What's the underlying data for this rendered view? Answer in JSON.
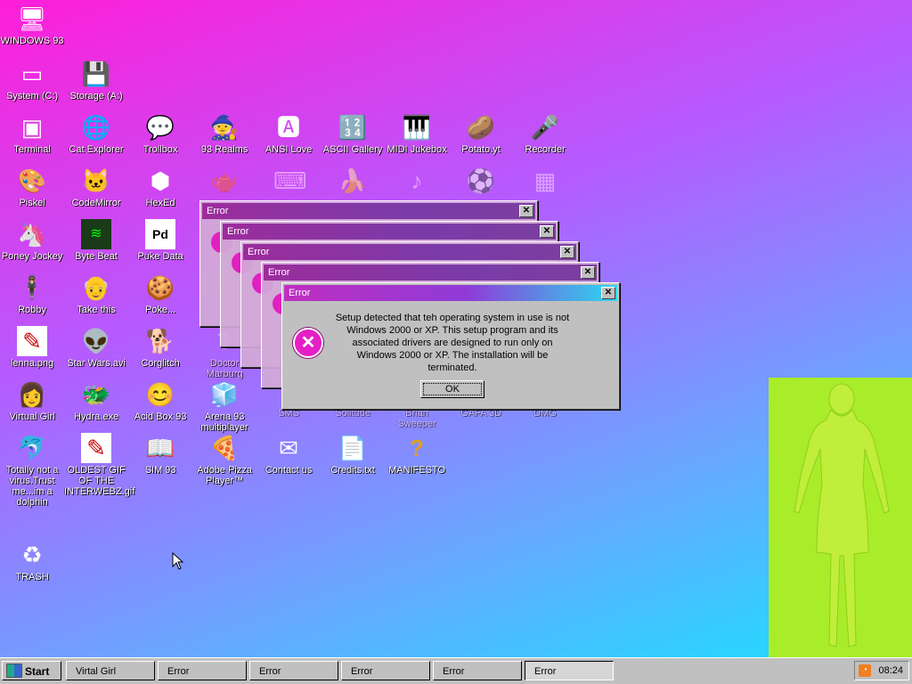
{
  "colors": {
    "error_icon": "#e61ec6",
    "title_gradient_start": "#c02ec0",
    "title_gradient_end": "#2bd8ef",
    "virtual_girl_bg": "#a8ec2a"
  },
  "desktop_icons": [
    {
      "label": "WINDOWS 93",
      "icon": "computer-icon"
    },
    {
      "label": "System (C:)",
      "icon": "drive-icon"
    },
    {
      "label": "Storage (A:)",
      "icon": "floppy-icon"
    },
    {
      "label": "Terminal",
      "icon": "terminal-icon"
    },
    {
      "label": "Cat Explorer",
      "icon": "cat-explorer-icon"
    },
    {
      "label": "Trollbox",
      "icon": "chat-bubble-icon"
    },
    {
      "label": "93 Realms",
      "icon": "realms-icon"
    },
    {
      "label": "ANSI Love",
      "icon": "ansi-icon"
    },
    {
      "label": "ASCII Gallery",
      "icon": "ascii-icon"
    },
    {
      "label": "MIDI Jukebox",
      "icon": "piano-icon"
    },
    {
      "label": "Potato.yt",
      "icon": "potato-icon"
    },
    {
      "label": "Recorder",
      "icon": "microphone-icon"
    },
    {
      "label": "Piskel",
      "icon": "palette-icon"
    },
    {
      "label": "CodeMirror",
      "icon": "codemirror-icon"
    },
    {
      "label": "HexEd",
      "icon": "hexed-icon"
    },
    {
      "label": "Poney Jockey",
      "icon": "pony-icon"
    },
    {
      "label": "Byte Beat",
      "icon": "bytebeat-icon"
    },
    {
      "label": "Puke Data",
      "icon": "pd-icon"
    },
    {
      "label": "Robby",
      "icon": "robby-icon"
    },
    {
      "label": "Take this",
      "icon": "take-this-icon"
    },
    {
      "label": "Poke...",
      "icon": "cookie-icon"
    },
    {
      "label": "lenna.png",
      "icon": "image-file-icon"
    },
    {
      "label": "Star Wars.avi",
      "icon": "yoda-icon"
    },
    {
      "label": "Corglitch",
      "icon": "corgi-icon"
    },
    {
      "label": "Doctor Marburg",
      "icon": "doctor-icon"
    },
    {
      "label": "Virtual Girl",
      "icon": "virtual-girl-icon"
    },
    {
      "label": "Hydra.exe",
      "icon": "hydra-icon"
    },
    {
      "label": "Acid Box 93",
      "icon": "smiley-icon"
    },
    {
      "label": "Arena 93 multiplayer",
      "icon": "cube-icon"
    },
    {
      "label": "SMS",
      "icon": "sms-icon"
    },
    {
      "label": "Solitude",
      "icon": "solitude-icon"
    },
    {
      "label": "Brian Sweeper",
      "icon": "sweeper-icon"
    },
    {
      "label": "GAFA 3D",
      "icon": "gafa-icon"
    },
    {
      "label": "DMG",
      "icon": "dmg-icon"
    },
    {
      "label": "Totally not a virus.Trust me...im a dolphin",
      "icon": "dolphin-icon"
    },
    {
      "label": "OLDEST GIF OF THE INTERWEBZ.gif",
      "icon": "gif-file-icon"
    },
    {
      "label": "SIM 93",
      "icon": "sim-icon"
    },
    {
      "label": "Adobe Pizza Player™",
      "icon": "pizza-icon"
    },
    {
      "label": "Contact us",
      "icon": "contact-icon"
    },
    {
      "label": "Credits.txt",
      "icon": "text-file-icon"
    },
    {
      "label": "MANIFESTO",
      "icon": "question-icon"
    },
    {
      "label": "TRASH",
      "icon": "recycle-bin-icon"
    }
  ],
  "error_windows": [
    {
      "title": "Error"
    },
    {
      "title": "Error"
    },
    {
      "title": "Error"
    },
    {
      "title": "Error"
    }
  ],
  "error_dialog": {
    "title": "Error",
    "close_label": "✕",
    "message": "Setup detected that teh operating system in use is not Windows 2000 or XP. This setup program and its associated drivers are designed to run only on Windows 2000 or XP. The installation will be terminated.",
    "ok_label": "OK"
  },
  "taskbar": {
    "start_label": "Start",
    "tasks": [
      "Virtal Girl",
      "Error",
      "Error",
      "Error",
      "Error",
      "Error"
    ],
    "clock": "08:24"
  }
}
